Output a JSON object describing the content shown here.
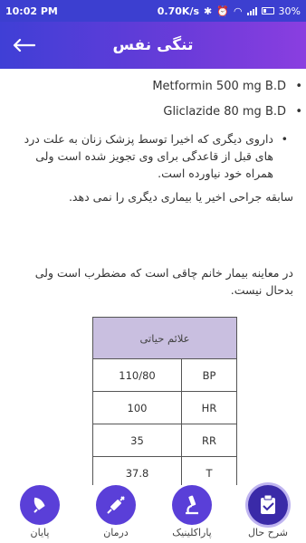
{
  "status": {
    "time": "10:02 PM",
    "net_speed": "0.70K/s",
    "battery": "30%"
  },
  "header": {
    "title": "تنگی نفس"
  },
  "meds": [
    "Metformin 500 mg B.D",
    "Gliclazide 80 mg B.D"
  ],
  "other_drug_note": "داروی دیگری که اخیرا توسط پزشک زنان به علت درد های قبل از قاعدگی برای وی تجویز شده است ولی همراه خود نیاورده است.",
  "surgery_note": "سابقه جراحی اخیر یا بیماری دیگری را نمی دهد.",
  "exam_note": "در معاینه بیمار خانم چاقی است که مضطرب است ولی بدحال نیست.",
  "vitals": {
    "header": "علائم حیاتی",
    "rows": [
      {
        "value": "110/80",
        "label": "BP"
      },
      {
        "value": "100",
        "label": "HR"
      },
      {
        "value": "35",
        "label": "RR"
      },
      {
        "value": "37.8",
        "label": "T"
      }
    ]
  },
  "nav": {
    "history": "شرح حال",
    "paraclinic": "پاراکلینیک",
    "treatment": "درمان",
    "end": "پایان"
  },
  "colors": {
    "primary": "#3f3fd6",
    "accent": "#8a3ee0",
    "table_header": "#c9bfe0"
  },
  "icons": [
    "back-arrow-icon",
    "clipboard-icon",
    "microscope-icon",
    "syringe-icon",
    "rocket-icon"
  ]
}
